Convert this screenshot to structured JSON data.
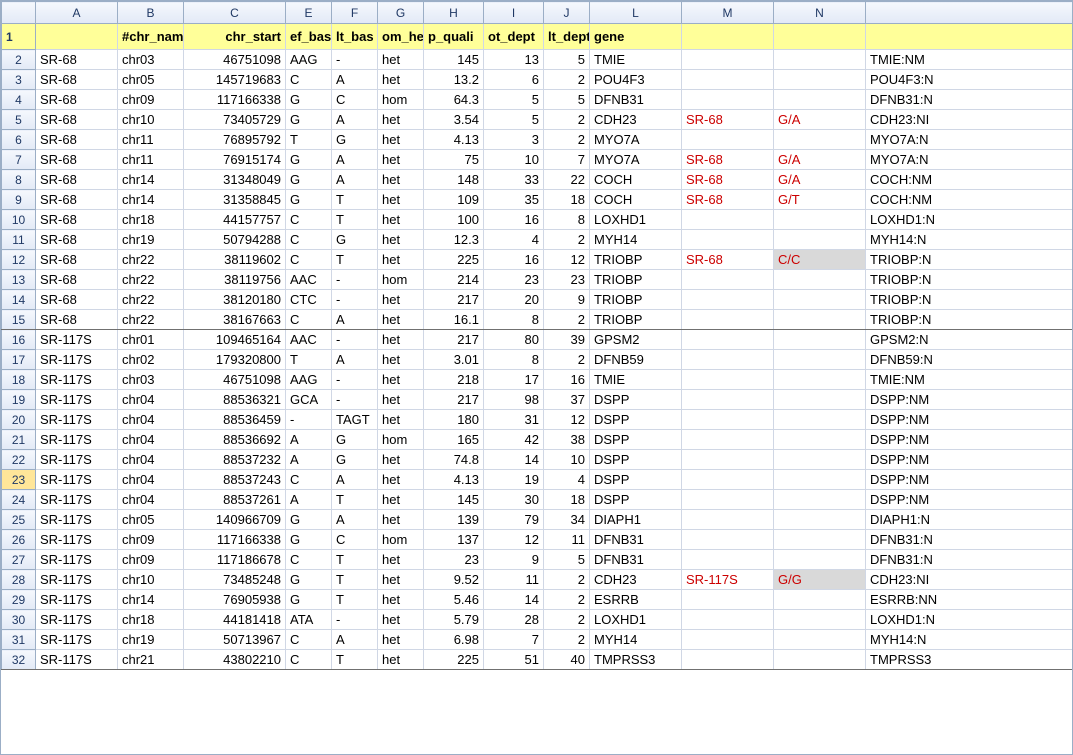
{
  "columns": {
    "corner": "",
    "letters": [
      "A",
      "B",
      "C",
      "E",
      "F",
      "G",
      "H",
      "I",
      "J",
      "L",
      "M",
      "N",
      ""
    ]
  },
  "header_row": {
    "cells": [
      "",
      "#chr_nam",
      "chr_start",
      "ef_bas",
      "lt_bas",
      "om_he",
      "p_quali",
      "ot_dept",
      "lt_dept",
      "gene",
      "",
      "",
      ""
    ],
    "align": [
      "txt",
      "txt",
      "right",
      "txt",
      "txt",
      "txt",
      "txt",
      "txt",
      "txt",
      "txt",
      "txt",
      "txt",
      "txt"
    ]
  },
  "selected_row_number": 23,
  "rows": [
    {
      "n": 2,
      "A": "SR-68",
      "B": "chr03",
      "C": "46751098",
      "E": "AAG",
      "F": "-",
      "G": "het",
      "H": "145",
      "I": "13",
      "J": "5",
      "L": "TMIE",
      "M": "",
      "N": "",
      "R": "TMIE:NM"
    },
    {
      "n": 3,
      "A": "SR-68",
      "B": "chr05",
      "C": "145719683",
      "E": "C",
      "F": "A",
      "G": "het",
      "H": "13.2",
      "I": "6",
      "J": "2",
      "L": "POU4F3",
      "M": "",
      "N": "",
      "R": "POU4F3:N"
    },
    {
      "n": 4,
      "A": "SR-68",
      "B": "chr09",
      "C": "117166338",
      "E": "G",
      "F": "C",
      "G": "hom",
      "H": "64.3",
      "I": "5",
      "J": "5",
      "L": "DFNB31",
      "M": "",
      "N": "",
      "R": "DFNB31:N"
    },
    {
      "n": 5,
      "A": "SR-68",
      "B": "chr10",
      "C": "73405729",
      "E": "G",
      "F": "A",
      "G": "het",
      "H": "3.54",
      "I": "5",
      "J": "2",
      "L": "CDH23",
      "M": "SR-68",
      "N": "G/A",
      "R": "CDH23:NI",
      "red": true
    },
    {
      "n": 6,
      "A": "SR-68",
      "B": "chr11",
      "C": "76895792",
      "E": "T",
      "F": "G",
      "G": "het",
      "H": "4.13",
      "I": "3",
      "J": "2",
      "L": "MYO7A",
      "M": "",
      "N": "",
      "R": "MYO7A:N"
    },
    {
      "n": 7,
      "A": "SR-68",
      "B": "chr11",
      "C": "76915174",
      "E": "G",
      "F": "A",
      "G": "het",
      "H": "75",
      "I": "10",
      "J": "7",
      "L": "MYO7A",
      "M": "SR-68",
      "N": "G/A",
      "R": "MYO7A:N",
      "red": true
    },
    {
      "n": 8,
      "A": "SR-68",
      "B": "chr14",
      "C": "31348049",
      "E": "G",
      "F": "A",
      "G": "het",
      "H": "148",
      "I": "33",
      "J": "22",
      "L": "COCH",
      "M": "SR-68",
      "N": "G/A",
      "R": "COCH:NM",
      "red": true
    },
    {
      "n": 9,
      "A": "SR-68",
      "B": "chr14",
      "C": "31358845",
      "E": "G",
      "F": "T",
      "G": "het",
      "H": "109",
      "I": "35",
      "J": "18",
      "L": "COCH",
      "M": "SR-68",
      "N": "G/T",
      "R": "COCH:NM",
      "red": true
    },
    {
      "n": 10,
      "A": "SR-68",
      "B": "chr18",
      "C": "44157757",
      "E": "C",
      "F": "T",
      "G": "het",
      "H": "100",
      "I": "16",
      "J": "8",
      "L": "LOXHD1",
      "M": "",
      "N": "",
      "R": "LOXHD1:N"
    },
    {
      "n": 11,
      "A": "SR-68",
      "B": "chr19",
      "C": "50794288",
      "E": "C",
      "F": "G",
      "G": "het",
      "H": "12.3",
      "I": "4",
      "J": "2",
      "L": "MYH14",
      "M": "",
      "N": "",
      "R": "MYH14:N"
    },
    {
      "n": 12,
      "A": "SR-68",
      "B": "chr22",
      "C": "38119602",
      "E": "C",
      "F": "T",
      "G": "het",
      "H": "225",
      "I": "16",
      "J": "12",
      "L": "TRIOBP",
      "M": "SR-68",
      "N": "C/C",
      "R": "TRIOBP:N",
      "red": true,
      "shaded_n": true
    },
    {
      "n": 13,
      "A": "SR-68",
      "B": "chr22",
      "C": "38119756",
      "E": "AAC",
      "F": "-",
      "G": "hom",
      "H": "214",
      "I": "23",
      "J": "23",
      "L": "TRIOBP",
      "M": "",
      "N": "",
      "R": "TRIOBP:N"
    },
    {
      "n": 14,
      "A": "SR-68",
      "B": "chr22",
      "C": "38120180",
      "E": "CTC",
      "F": "-",
      "G": "het",
      "H": "217",
      "I": "20",
      "J": "9",
      "L": "TRIOBP",
      "M": "",
      "N": "",
      "R": "TRIOBP:N"
    },
    {
      "n": 15,
      "A": "SR-68",
      "B": "chr22",
      "C": "38167663",
      "E": "C",
      "F": "A",
      "G": "het",
      "H": "16.1",
      "I": "8",
      "J": "2",
      "L": "TRIOBP",
      "M": "",
      "N": "",
      "R": "TRIOBP:N",
      "groupend": true
    },
    {
      "n": 16,
      "A": "SR-117S",
      "B": "chr01",
      "C": "109465164",
      "E": "AAC",
      "F": "-",
      "G": "het",
      "H": "217",
      "I": "80",
      "J": "39",
      "L": "GPSM2",
      "M": "",
      "N": "",
      "R": "GPSM2:N"
    },
    {
      "n": 17,
      "A": "SR-117S",
      "B": "chr02",
      "C": "179320800",
      "E": "T",
      "F": "A",
      "G": "het",
      "H": "3.01",
      "I": "8",
      "J": "2",
      "L": "DFNB59",
      "M": "",
      "N": "",
      "R": "DFNB59:N"
    },
    {
      "n": 18,
      "A": "SR-117S",
      "B": "chr03",
      "C": "46751098",
      "E": "AAG",
      "F": "-",
      "G": "het",
      "H": "218",
      "I": "17",
      "J": "16",
      "L": "TMIE",
      "M": "",
      "N": "",
      "R": "TMIE:NM"
    },
    {
      "n": 19,
      "A": "SR-117S",
      "B": "chr04",
      "C": "88536321",
      "E": "GCA",
      "F": "-",
      "G": "het",
      "H": "217",
      "I": "98",
      "J": "37",
      "L": "DSPP",
      "M": "",
      "N": "",
      "R": "DSPP:NM"
    },
    {
      "n": 20,
      "A": "SR-117S",
      "B": "chr04",
      "C": "88536459",
      "E": "-",
      "F": "TAGT",
      "G": "het",
      "H": "180",
      "I": "31",
      "J": "12",
      "L": "DSPP",
      "M": "",
      "N": "",
      "R": "DSPP:NM"
    },
    {
      "n": 21,
      "A": "SR-117S",
      "B": "chr04",
      "C": "88536692",
      "E": "A",
      "F": "G",
      "G": "hom",
      "H": "165",
      "I": "42",
      "J": "38",
      "L": "DSPP",
      "M": "",
      "N": "",
      "R": "DSPP:NM"
    },
    {
      "n": 22,
      "A": "SR-117S",
      "B": "chr04",
      "C": "88537232",
      "E": "A",
      "F": "G",
      "G": "het",
      "H": "74.8",
      "I": "14",
      "J": "10",
      "L": "DSPP",
      "M": "",
      "N": "",
      "R": "DSPP:NM"
    },
    {
      "n": 23,
      "A": "SR-117S",
      "B": "chr04",
      "C": "88537243",
      "E": "C",
      "F": "A",
      "G": "het",
      "H": "4.13",
      "I": "19",
      "J": "4",
      "L": "DSPP",
      "M": "",
      "N": "",
      "R": "DSPP:NM"
    },
    {
      "n": 24,
      "A": "SR-117S",
      "B": "chr04",
      "C": "88537261",
      "E": "A",
      "F": "T",
      "G": "het",
      "H": "145",
      "I": "30",
      "J": "18",
      "L": "DSPP",
      "M": "",
      "N": "",
      "R": "DSPP:NM"
    },
    {
      "n": 25,
      "A": "SR-117S",
      "B": "chr05",
      "C": "140966709",
      "E": "G",
      "F": "A",
      "G": "het",
      "H": "139",
      "I": "79",
      "J": "34",
      "L": "DIAPH1",
      "M": "",
      "N": "",
      "R": "DIAPH1:N"
    },
    {
      "n": 26,
      "A": "SR-117S",
      "B": "chr09",
      "C": "117166338",
      "E": "G",
      "F": "C",
      "G": "hom",
      "H": "137",
      "I": "12",
      "J": "11",
      "L": "DFNB31",
      "M": "",
      "N": "",
      "R": "DFNB31:N"
    },
    {
      "n": 27,
      "A": "SR-117S",
      "B": "chr09",
      "C": "117186678",
      "E": "C",
      "F": "T",
      "G": "het",
      "H": "23",
      "I": "9",
      "J": "5",
      "L": "DFNB31",
      "M": "",
      "N": "",
      "R": "DFNB31:N"
    },
    {
      "n": 28,
      "A": "SR-117S",
      "B": "chr10",
      "C": "73485248",
      "E": "G",
      "F": "T",
      "G": "het",
      "H": "9.52",
      "I": "11",
      "J": "2",
      "L": "CDH23",
      "M": "SR-117S",
      "N": "G/G",
      "R": "CDH23:NI",
      "red": true,
      "shaded_n": true
    },
    {
      "n": 29,
      "A": "SR-117S",
      "B": "chr14",
      "C": "76905938",
      "E": "G",
      "F": "T",
      "G": "het",
      "H": "5.46",
      "I": "14",
      "J": "2",
      "L": "ESRRB",
      "M": "",
      "N": "",
      "R": "ESRRB:NN"
    },
    {
      "n": 30,
      "A": "SR-117S",
      "B": "chr18",
      "C": "44181418",
      "E": "ATA",
      "F": "-",
      "G": "het",
      "H": "5.79",
      "I": "28",
      "J": "2",
      "L": "LOXHD1",
      "M": "",
      "N": "",
      "R": "LOXHD1:N"
    },
    {
      "n": 31,
      "A": "SR-117S",
      "B": "chr19",
      "C": "50713967",
      "E": "C",
      "F": "A",
      "G": "het",
      "H": "6.98",
      "I": "7",
      "J": "2",
      "L": "MYH14",
      "M": "",
      "N": "",
      "R": "MYH14:N"
    },
    {
      "n": 32,
      "A": "SR-117S",
      "B": "chr21",
      "C": "43802210",
      "E": "C",
      "F": "T",
      "G": "het",
      "H": "225",
      "I": "51",
      "J": "40",
      "L": "TMPRSS3",
      "M": "",
      "N": "",
      "R": "TMPRSS3",
      "groupend": true
    }
  ]
}
